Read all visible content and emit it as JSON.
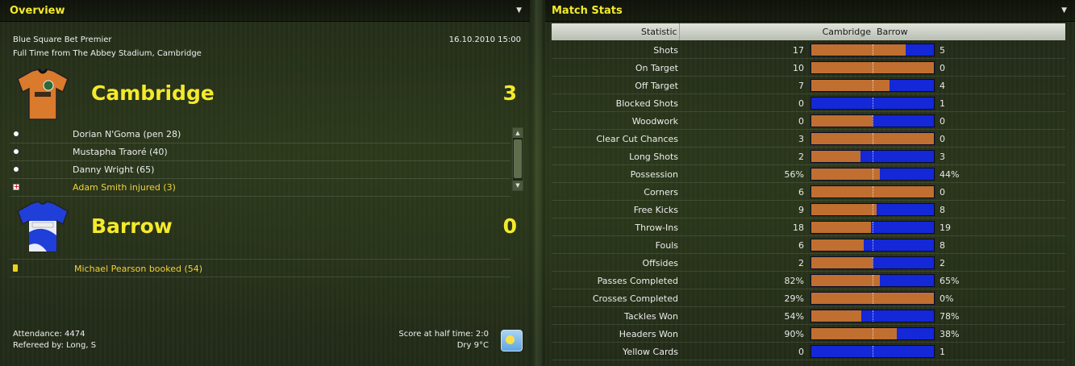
{
  "overview": {
    "title": "Overview",
    "competition": "Blue Square Bet Premier",
    "datetime": "16.10.2010 15:00",
    "venue": "Full Time from The Abbey Stadium, Cambridge",
    "home": {
      "name": "Cambridge",
      "score": "3",
      "kit_colors": {
        "primary": "#d97a2c",
        "secondary": "#111111"
      },
      "events": [
        {
          "icon": "goal-ball-icon",
          "text": "Dorian N'Goma (pen 28)"
        },
        {
          "icon": "goal-ball-icon",
          "text": "Mustapha Traoré (40)"
        },
        {
          "icon": "goal-ball-icon",
          "text": "Danny Wright (65)"
        },
        {
          "icon": "injury-icon",
          "text": "Adam Smith injured (3)"
        }
      ]
    },
    "away": {
      "name": "Barrow",
      "score": "0",
      "kit_colors": {
        "primary": "#1f3fd8",
        "secondary": "#ffffff"
      },
      "events": [
        {
          "icon": "yellow-card-icon",
          "text": "Michael Pearson booked (54)"
        }
      ]
    },
    "attendance": "Attendance: 4474",
    "referee": "Refereed by: Long, S",
    "half_time": "Score at half time: 2:0",
    "weather": "Dry 9°C",
    "accent_color": "#f4ea2a",
    "event_highlight_color": "#f0d23a"
  },
  "match_stats": {
    "title": "Match Stats",
    "header": {
      "statistic": "Statistic",
      "home": "Cambridge",
      "away": "Barrow"
    },
    "colors": {
      "home_bar": "#c06f31",
      "away_bar": "#1428d8"
    },
    "rows": [
      {
        "label": "Shots",
        "home": "17",
        "away": "5",
        "home_share": 0.77
      },
      {
        "label": "On Target",
        "home": "10",
        "away": "0",
        "home_share": 1.0
      },
      {
        "label": "Off Target",
        "home": "7",
        "away": "4",
        "home_share": 0.64
      },
      {
        "label": "Blocked Shots",
        "home": "0",
        "away": "1",
        "home_share": 0.0
      },
      {
        "label": "Woodwork",
        "home": "0",
        "away": "0",
        "home_share": 0.5
      },
      {
        "label": "Clear Cut Chances",
        "home": "3",
        "away": "0",
        "home_share": 1.0
      },
      {
        "label": "Long Shots",
        "home": "2",
        "away": "3",
        "home_share": 0.4
      },
      {
        "label": "Possession",
        "home": "56%",
        "away": "44%",
        "home_share": 0.56
      },
      {
        "label": "Corners",
        "home": "6",
        "away": "0",
        "home_share": 1.0
      },
      {
        "label": "Free Kicks",
        "home": "9",
        "away": "8",
        "home_share": 0.53
      },
      {
        "label": "Throw-Ins",
        "home": "18",
        "away": "19",
        "home_share": 0.49
      },
      {
        "label": "Fouls",
        "home": "6",
        "away": "8",
        "home_share": 0.43
      },
      {
        "label": "Offsides",
        "home": "2",
        "away": "2",
        "home_share": 0.5
      },
      {
        "label": "Passes Completed",
        "home": "82%",
        "away": "65%",
        "home_share": 0.56
      },
      {
        "label": "Crosses Completed",
        "home": "29%",
        "away": "0%",
        "home_share": 1.0
      },
      {
        "label": "Tackles Won",
        "home": "54%",
        "away": "78%",
        "home_share": 0.41
      },
      {
        "label": "Headers Won",
        "home": "90%",
        "away": "38%",
        "home_share": 0.7
      },
      {
        "label": "Yellow Cards",
        "home": "0",
        "away": "1",
        "home_share": 0.0
      }
    ]
  }
}
